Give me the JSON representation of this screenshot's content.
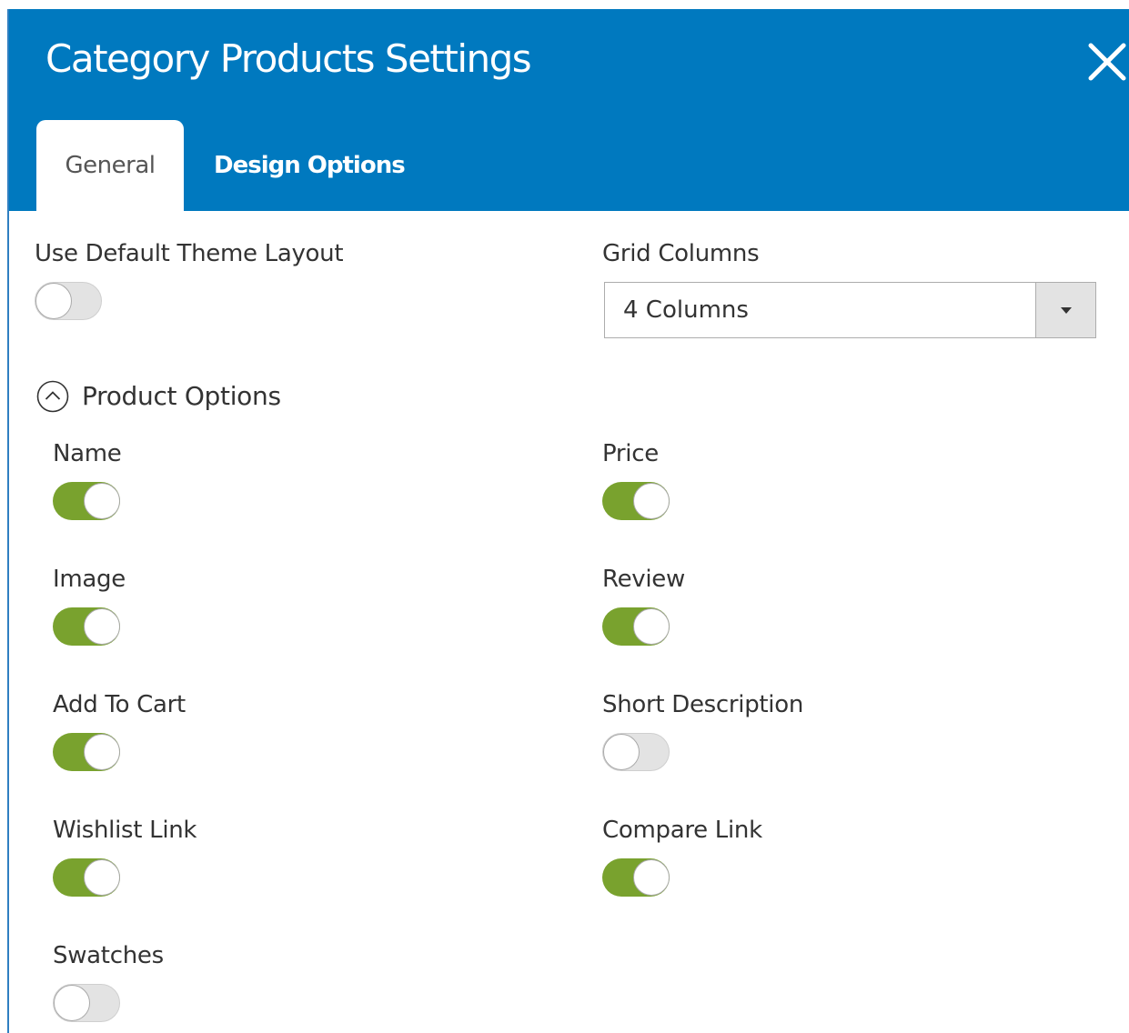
{
  "modal": {
    "title": "Category Products Settings",
    "close_icon": "close-icon"
  },
  "tabs": [
    {
      "label": "General",
      "active": true
    },
    {
      "label": "Design Options",
      "active": false
    }
  ],
  "general": {
    "use_default_layout": {
      "label": "Use Default Theme Layout",
      "enabled": false
    },
    "grid_columns": {
      "label": "Grid Columns",
      "value": "4 Columns"
    }
  },
  "product_options": {
    "title": "Product Options",
    "icon": "chevron-up-circle-icon",
    "items": [
      {
        "label": "Name",
        "enabled": true
      },
      {
        "label": "Price",
        "enabled": true
      },
      {
        "label": "Image",
        "enabled": true
      },
      {
        "label": "Review",
        "enabled": true
      },
      {
        "label": "Add To Cart",
        "enabled": true
      },
      {
        "label": "Short Description",
        "enabled": false
      },
      {
        "label": "Wishlist Link",
        "enabled": true
      },
      {
        "label": "Compare Link",
        "enabled": true
      },
      {
        "label": "Swatches",
        "enabled": false
      }
    ]
  },
  "colors": {
    "header_bg": "#0079bf",
    "toggle_on": "#79a22e",
    "toggle_off": "#e3e3e3"
  }
}
